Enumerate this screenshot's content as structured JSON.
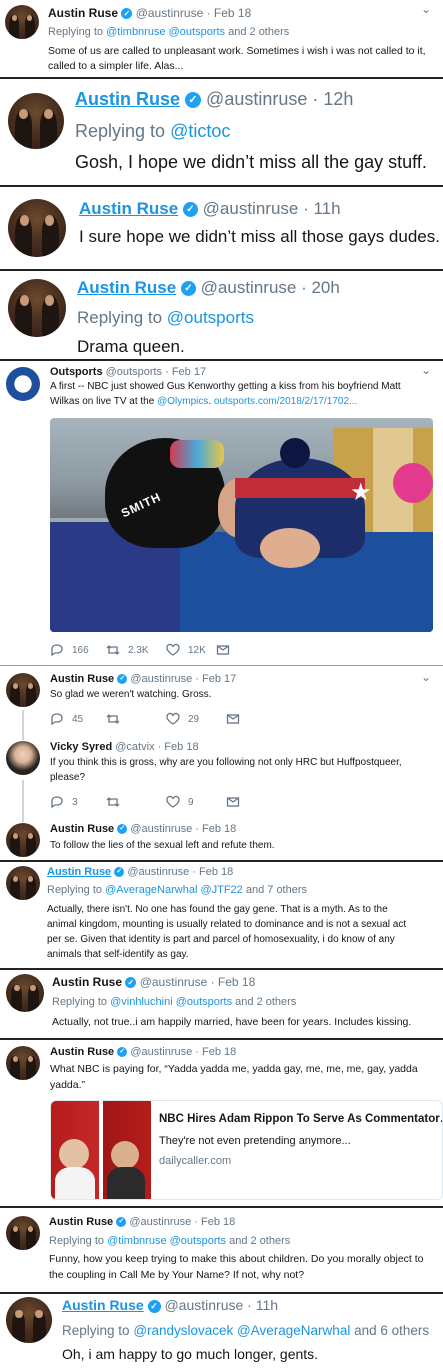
{
  "colors": {
    "link": "#1b95e0",
    "verified": "#1da1f2",
    "muted": "#657786",
    "text": "#14171a"
  },
  "icons": {
    "verified": "verified-badge-icon",
    "chevron": "chevron-down-icon",
    "reply": "reply-icon",
    "retweet": "retweet-icon",
    "like": "heart-icon",
    "message": "envelope-icon"
  },
  "verified_mark": "✓",
  "chevron_mark": "⌄",
  "t1": {
    "name": "Austin Ruse",
    "handle": "@austinruse · Feb 18",
    "replying": "Replying to",
    "mentions": "@timbnruse @outsports",
    "and": "and 2 others",
    "line1": "Some of us are called to unpleasant work. Sometimes i wish i was not called to it,",
    "line2": "called to a simpler life. Alas..."
  },
  "t2": {
    "name": "Austin Ruse",
    "handle": "@austinruse · 12h",
    "replying": "Replying to",
    "mention": "@tictoc",
    "text": "Gosh, I hope we didn’t miss all the gay stuff."
  },
  "t3": {
    "name": "Austin Ruse",
    "handle": "@austinruse · 11h",
    "text": "I sure hope we didn’t miss all those gays dudes."
  },
  "t4": {
    "name": "Austin Ruse",
    "handle": "@austinruse · 20h",
    "replying": "Replying to",
    "mention": "@outsports",
    "text": "Drama queen."
  },
  "t5": {
    "name": "Outsports",
    "handle": "@outsports · Feb 17",
    "line1": "A first -- NBC just showed Gus Kenworthy getting a kiss from his boyfriend Matt",
    "line2_a": "Wilkas on live TV at the",
    "line2_tag": "@Olympics",
    "line2_b": ".",
    "line2_link": "outsports.com/2018/2/17/1702...",
    "image_caption": "SMITH",
    "replies": "166",
    "retweets": "2.3K",
    "likes": "12K"
  },
  "t6": {
    "name": "Austin Ruse",
    "handle": "@austinruse · Feb 17",
    "text": "So glad we weren't watching. Gross.",
    "replies": "45",
    "retweets": "",
    "likes": "29"
  },
  "t7": {
    "name": "Vicky Syred",
    "handle": "@catvix · Feb 18",
    "line1": "If you think this is gross, why are you following not only HRC but Huffpostqueer,",
    "line2": "please?",
    "replies": "3",
    "retweets": "",
    "likes": "9"
  },
  "t8": {
    "name": "Austin Ruse",
    "handle": "@austinruse · Feb 18",
    "text": "To follow the lies of the sexual left and refute them."
  },
  "t9": {
    "name": "Austin Ruse",
    "handle": "@austinruse · Feb 18",
    "replying": "Replying to",
    "mentions": "@AverageNarwhal @JTF22",
    "and": "and 7 others",
    "lines": [
      "Actually, there isn't. No one has found the gay gene. That is a myth. As to the",
      "animal kingdom, mounting is usually related to dominance and is not a sexual act",
      "per se. Given that identity is part and parcel of homosexuality, i do know of any",
      "animals that self-identify as gay."
    ]
  },
  "t10": {
    "name": "Austin Ruse",
    "handle": "@austinruse · Feb 18",
    "replying": "Replying to",
    "mentions": "@vinhluchini @outsports",
    "and": "and 2 others",
    "text": "Actually, not true..i am happily married, have been for years. Includes kissing."
  },
  "t11": {
    "name": "Austin Ruse",
    "handle": "@austinruse · Feb 18",
    "line1": "What NBC is paying for, “Yadda yadda me, yadda gay, me, me, me, gay, yadda",
    "line2": "yadda.”",
    "card_title": "NBC Hires Adam Rippon To Serve As Commentator…",
    "card_desc": "They're not even pretending anymore...",
    "card_domain": "dailycaller.com"
  },
  "t12": {
    "name": "Austin Ruse",
    "handle": "@austinruse · Feb 18",
    "replying": "Replying to",
    "mentions": "@timbnruse @outsports",
    "and": "and 2 others",
    "line1": "Funny, how you keep trying to make this about children. Do you morally object to",
    "line2": "the coupling in Call Me by Your Name? If not, why not?"
  },
  "t13": {
    "name": "Austin Ruse",
    "handle": "@austinruse · 11h",
    "replying": "Replying to",
    "mentions": "@randyslovacek @AverageNarwhal",
    "and": "and 6 others",
    "text": "Oh, i am happy to go much longer, gents."
  }
}
